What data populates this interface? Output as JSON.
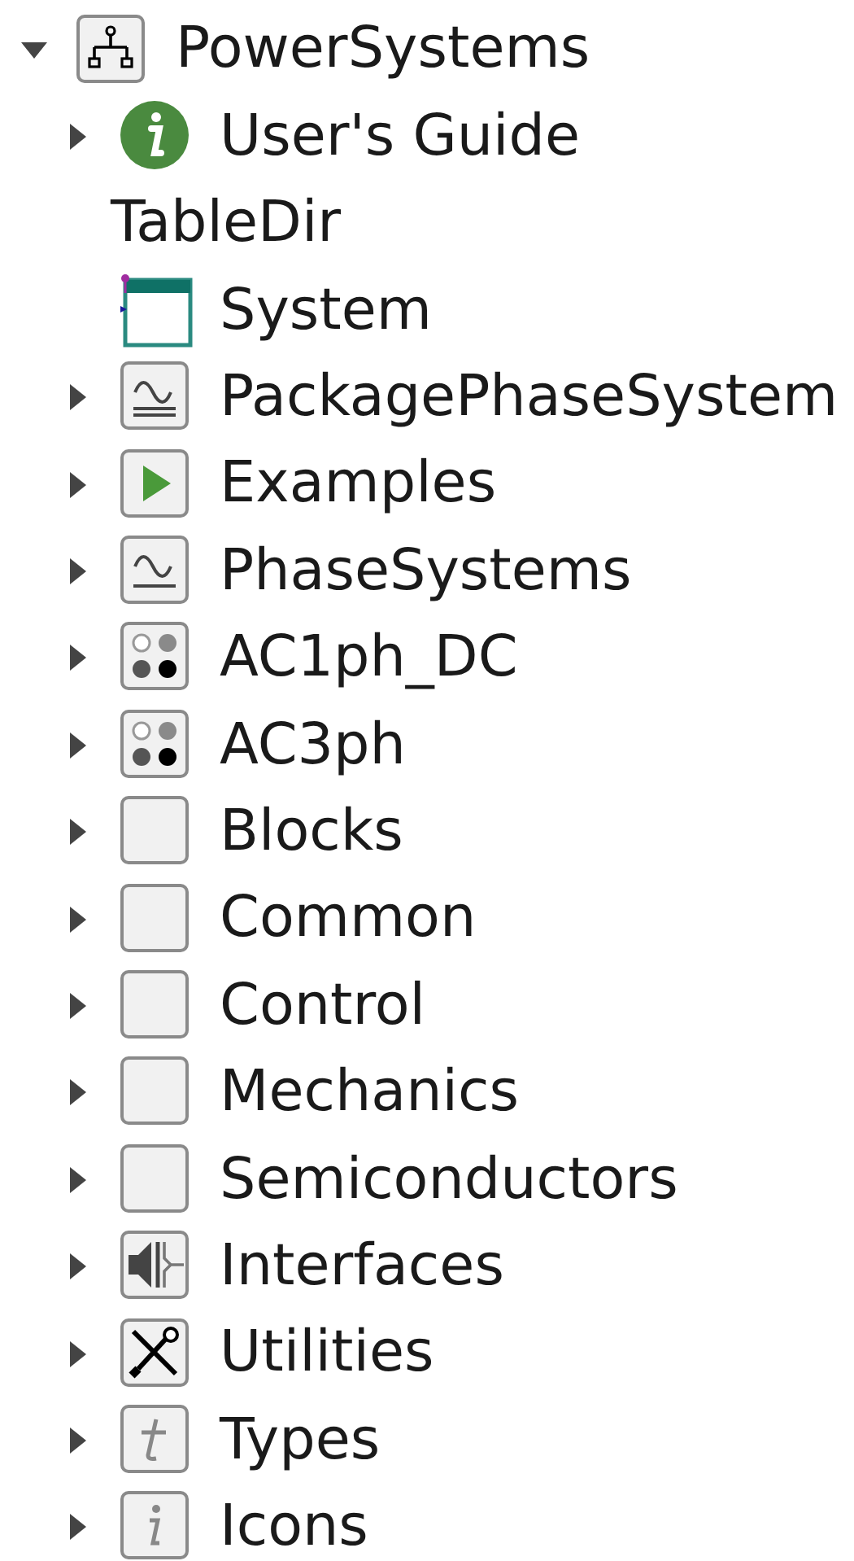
{
  "tree": [
    {
      "label": "PowerSystems",
      "kind": "package",
      "expanded": true,
      "children": [
        {
          "label": "User's Guide",
          "kind": "info",
          "expanded": false
        },
        {
          "label": "TableDir",
          "kind": "text"
        },
        {
          "label": "System",
          "kind": "record"
        },
        {
          "label": "PackagePhaseSystem",
          "kind": "phase-package",
          "expanded": false
        },
        {
          "label": "Examples",
          "kind": "examples",
          "expanded": false
        },
        {
          "label": "PhaseSystems",
          "kind": "phase",
          "expanded": false
        },
        {
          "label": "AC1ph_DC",
          "kind": "dots",
          "expanded": false
        },
        {
          "label": "AC3ph",
          "kind": "dots",
          "expanded": false
        },
        {
          "label": "Blocks",
          "kind": "blank",
          "expanded": false
        },
        {
          "label": "Common",
          "kind": "blank",
          "expanded": false
        },
        {
          "label": "Control",
          "kind": "blank",
          "expanded": false
        },
        {
          "label": "Mechanics",
          "kind": "blank",
          "expanded": false
        },
        {
          "label": "Semiconductors",
          "kind": "blank",
          "expanded": false
        },
        {
          "label": "Interfaces",
          "kind": "interfaces",
          "expanded": false
        },
        {
          "label": "Utilities",
          "kind": "utilities",
          "expanded": false
        },
        {
          "label": "Types",
          "kind": "types",
          "expanded": false
        },
        {
          "label": "Icons",
          "kind": "icons",
          "expanded": false
        }
      ]
    }
  ]
}
